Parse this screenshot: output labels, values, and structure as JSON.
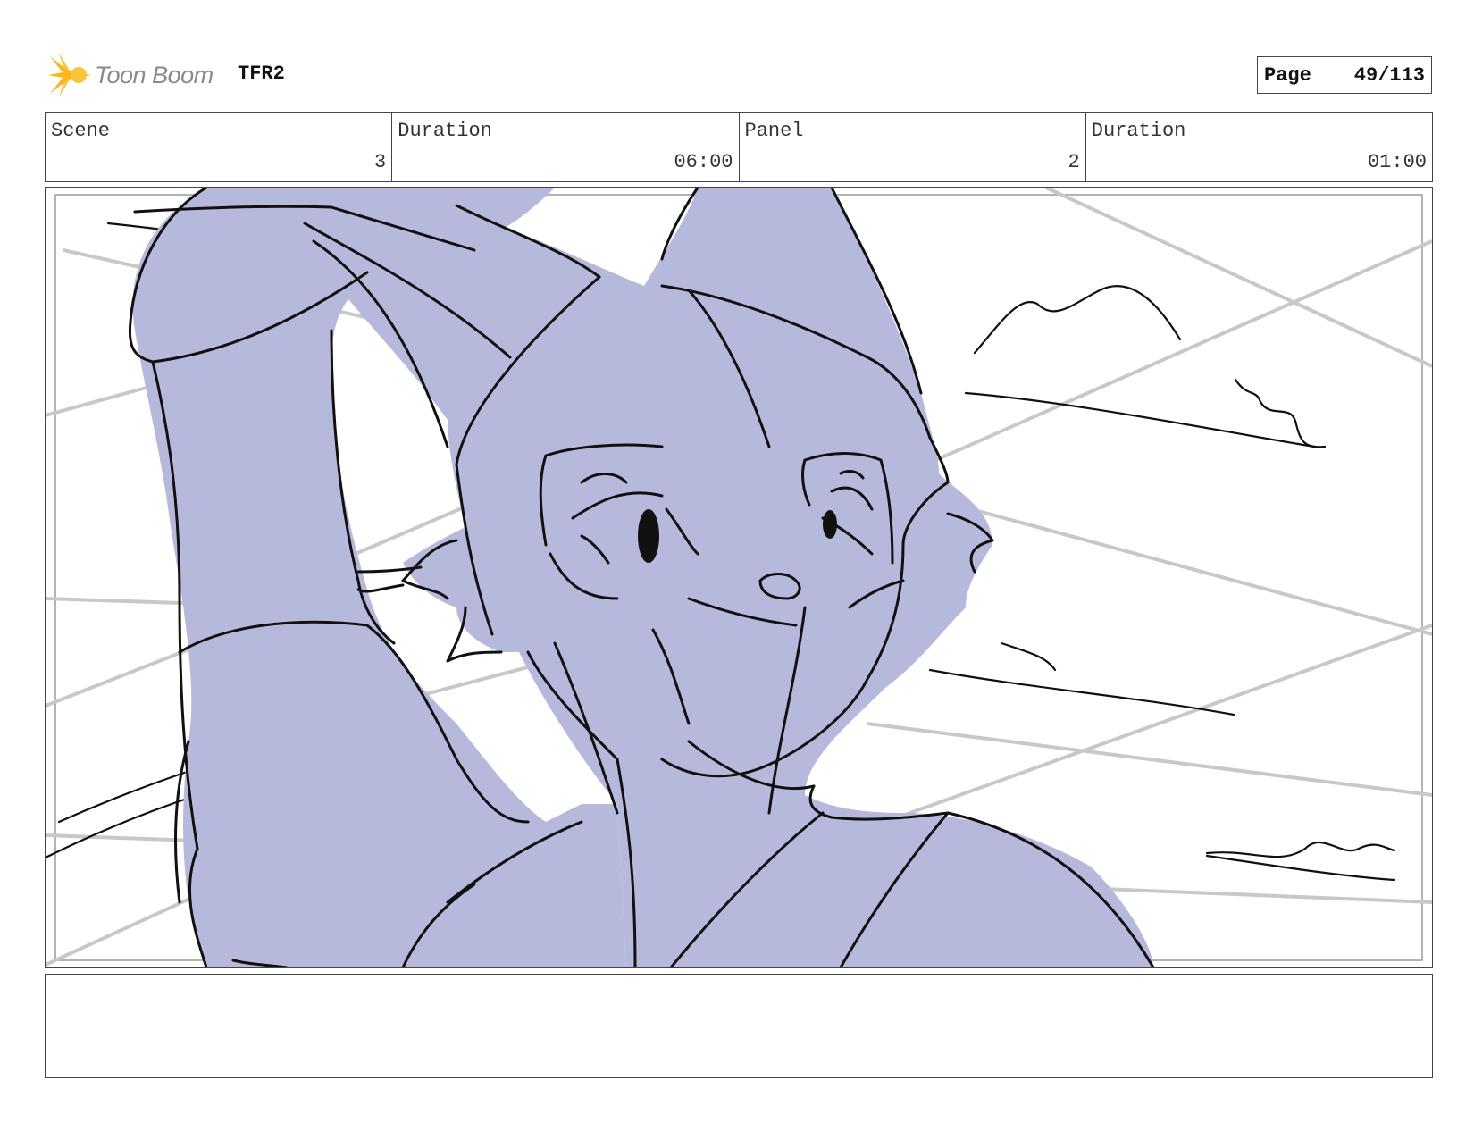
{
  "header": {
    "logo_text": "Toon Boom",
    "project_title": "TFR2",
    "page_label": "Page",
    "page_number": "49/113"
  },
  "info": {
    "scene_label": "Scene",
    "scene_value": "3",
    "scene_duration_label": "Duration",
    "scene_duration_value": "06:00",
    "panel_label": "Panel",
    "panel_value": "2",
    "panel_duration_label": "Duration",
    "panel_duration_value": "01:00"
  },
  "notes": {
    "text": ""
  },
  "colors": {
    "character_fill": "#b7b9dc",
    "logo_yellow": "#f6b81b",
    "logo_text": "#8a8a8a",
    "guide_lines": "#c8c8c8"
  },
  "icons": {
    "logo": "toon-boom-star-icon"
  }
}
